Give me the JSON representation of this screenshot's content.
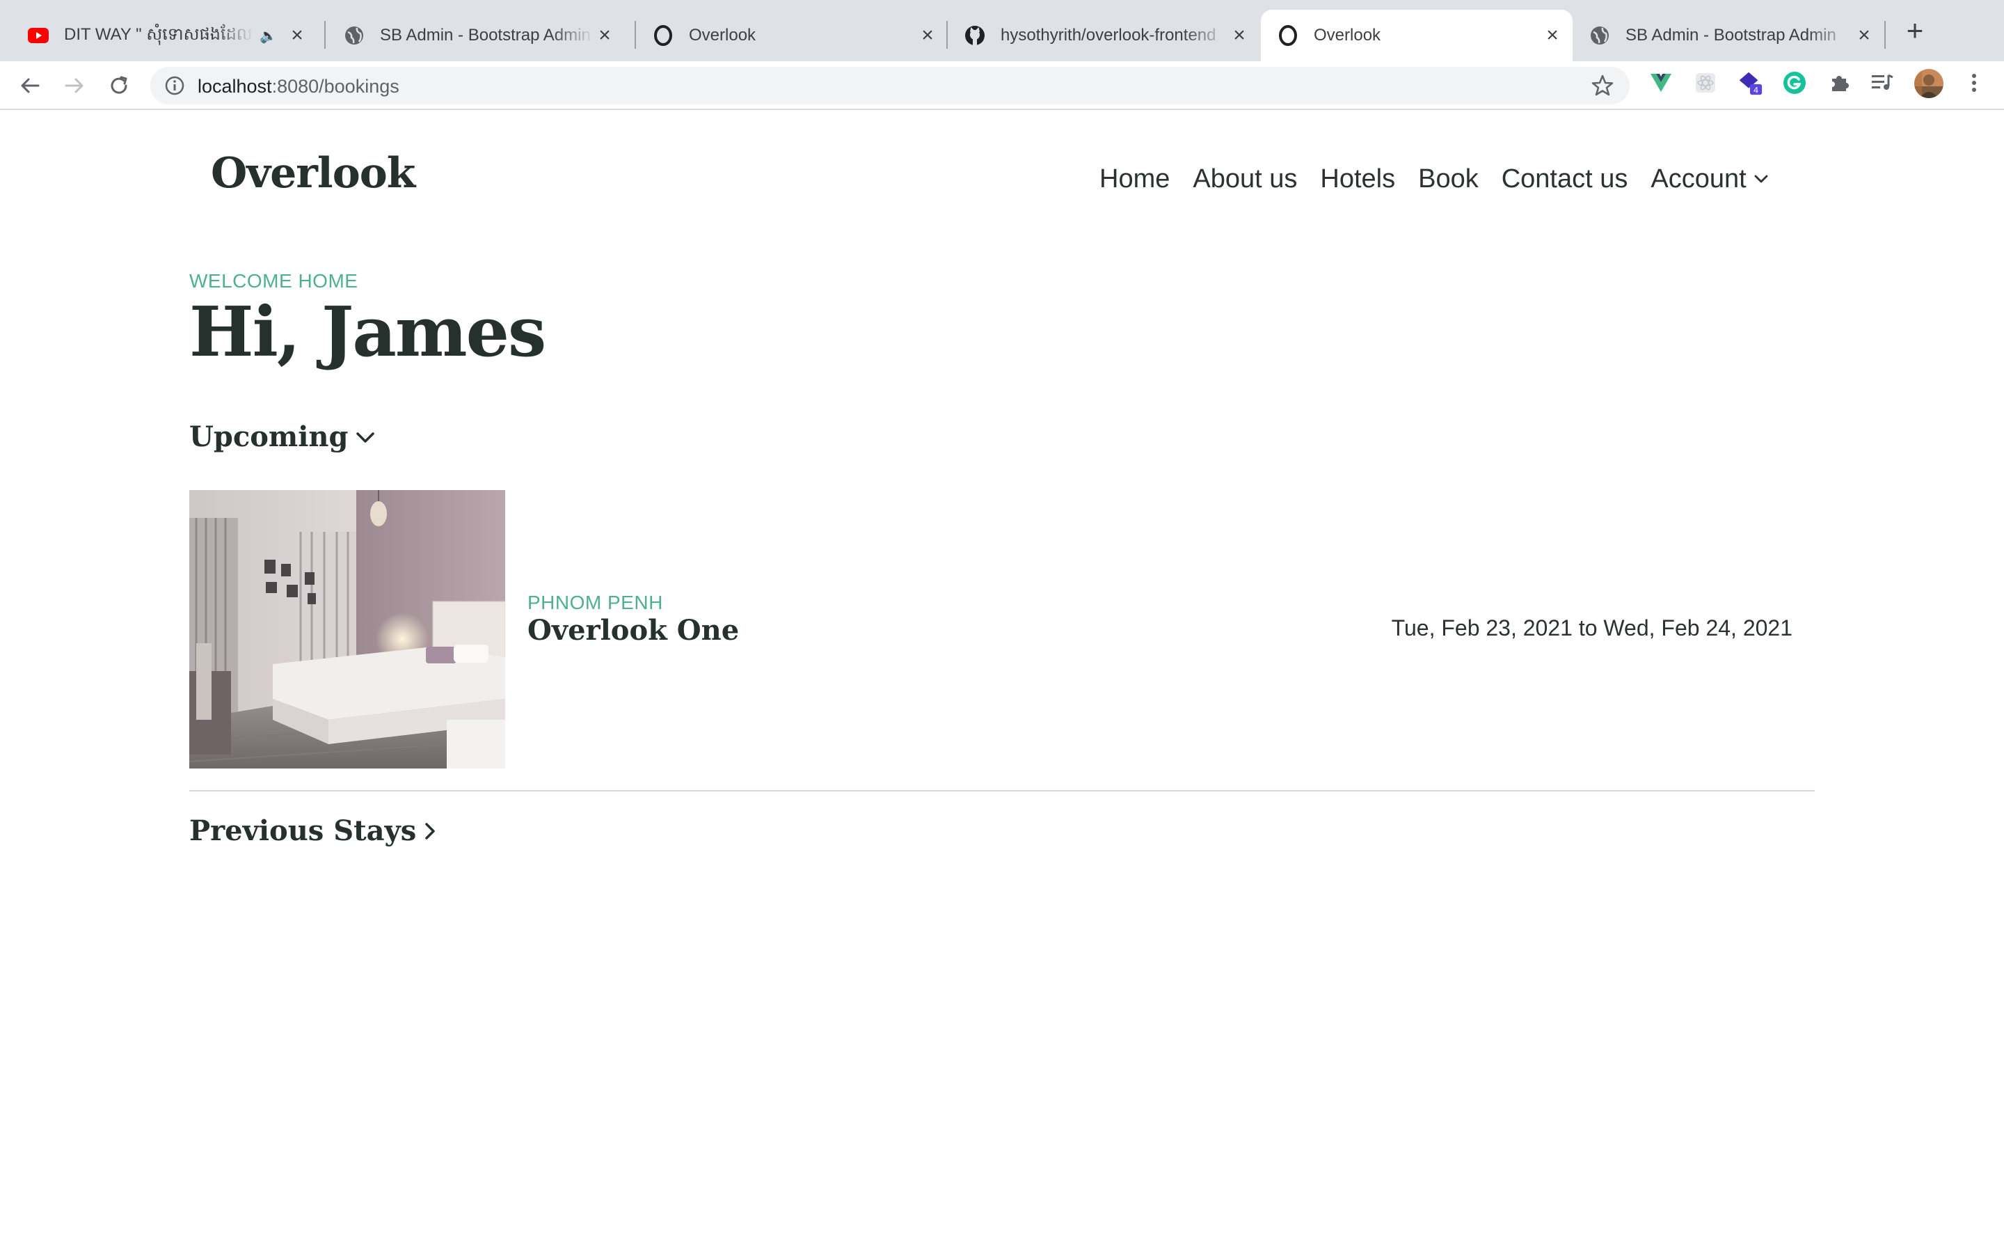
{
  "browser": {
    "tabs": [
      {
        "title": "DIT WAY \" សុំទោសផងដែល",
        "favicon": "youtube-icon"
      },
      {
        "title": "SB Admin - Bootstrap Admin",
        "favicon": "globe-icon"
      },
      {
        "title": "Overlook",
        "favicon": "overlook-o-icon"
      },
      {
        "title": "hysothyrith/overlook-frontend",
        "favicon": "github-icon"
      },
      {
        "title": "Overlook",
        "favicon": "overlook-o-icon",
        "active": true
      },
      {
        "title": "SB Admin - Bootstrap Admin",
        "favicon": "globe-icon"
      }
    ],
    "url_host": "localhost",
    "url_path": ":8080/bookings",
    "extension_badge": "4"
  },
  "site": {
    "brand": "Overlook",
    "nav": {
      "home": "Home",
      "about": "About us",
      "hotels": "Hotels",
      "book": "Book",
      "contact": "Contact us",
      "account": "Account"
    }
  },
  "greeting": {
    "eyebrow": "WELCOME HOME",
    "headline": "Hi, James"
  },
  "upcoming": {
    "heading": "Upcoming",
    "bookings": [
      {
        "city": "PHNOM PENH",
        "hotel": "Overlook One",
        "dates": "Tue, Feb 23, 2021 to Wed, Feb 24, 2021"
      }
    ]
  },
  "previous": {
    "heading": "Previous Stays"
  },
  "colors": {
    "accent": "#4fb08f",
    "heading": "#26302d",
    "tabstrip": "#dee1e6"
  }
}
